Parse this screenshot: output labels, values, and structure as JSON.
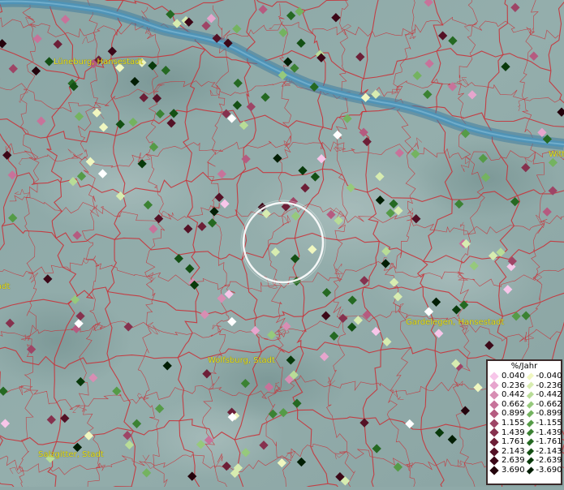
{
  "cities": [
    {
      "id": "lueneburg",
      "name": "Lüneburg, Hansestadt"
    },
    {
      "id": "wolfsburg",
      "name": "Wolfsburg, Stadt"
    },
    {
      "id": "gardelegen",
      "name": "Gardelegen, Hansestadt"
    },
    {
      "id": "salzgitter",
      "name": "Salzgitter, Stadt"
    },
    {
      "id": "witt",
      "name": "Witt"
    },
    {
      "id": "stadt-left",
      "name": "adt"
    }
  ],
  "legend": {
    "title": "%/Jahr",
    "positive": [
      {
        "label": "0.040",
        "color": "#f7c6e9"
      },
      {
        "label": "0.236",
        "color": "#e6a5cd"
      },
      {
        "label": "0.442",
        "color": "#d78eb3"
      },
      {
        "label": "0.662",
        "color": "#c7739a"
      },
      {
        "label": "0.899",
        "color": "#b55b80"
      },
      {
        "label": "1.155",
        "color": "#9e4566"
      },
      {
        "label": "1.439",
        "color": "#86314e"
      },
      {
        "label": "1.761",
        "color": "#6d1f37"
      },
      {
        "label": "2.143",
        "color": "#541126"
      },
      {
        "label": "2.639",
        "color": "#3c0818"
      },
      {
        "label": "3.690",
        "color": "#24030c"
      }
    ],
    "negative": [
      {
        "label": "-0.040",
        "color": "#f0f7c0"
      },
      {
        "label": "-0.236",
        "color": "#d7ecb0"
      },
      {
        "label": "-0.442",
        "color": "#b8dc97"
      },
      {
        "label": "-0.662",
        "color": "#96c97c"
      },
      {
        "label": "-0.899",
        "color": "#74b360"
      },
      {
        "label": "-1.155",
        "color": "#559b47"
      },
      {
        "label": "-1.439",
        "color": "#3b8233"
      },
      {
        "label": "-1.761",
        "color": "#256922"
      },
      {
        "label": "-2.143",
        "color": "#145014"
      },
      {
        "label": "-2.639",
        "color": "#093a0b"
      },
      {
        "label": "-3.690",
        "color": "#021e04"
      }
    ]
  },
  "colors": {
    "background": "#8fa9a8",
    "river": "#4f93b6",
    "boundaries": "#c8333a",
    "city_labels": "#e8e020",
    "white_point": "#ffffff"
  },
  "icons": {
    "selection": "circle-highlight",
    "measurement": "diamond-marker"
  }
}
